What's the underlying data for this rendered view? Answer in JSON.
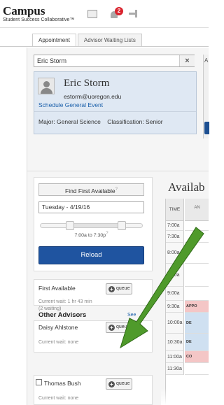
{
  "header": {
    "brand_name": "Campus",
    "brand_tagline": "Student Success Collaborative",
    "brand_tm": "™",
    "notification_count": "2"
  },
  "tabs": [
    {
      "label": "Appointment",
      "active": true
    },
    {
      "label": "Advisor Waiting Lists",
      "active": false
    }
  ],
  "student_search": {
    "value": "Eric Storm",
    "clear": "×"
  },
  "student_card": {
    "name": "Eric Storm",
    "email": "estorm@uoregon.edu",
    "action_link": "Schedule General Event",
    "info": "Major: General Science    Classification: Senior"
  },
  "right_panel": {
    "initial": "A"
  },
  "controls": {
    "find_first_label": "Find First Available",
    "help_mark": "?",
    "date_value": "Tuesday - 4/19/16",
    "time_range": "7:00a to 7:30p",
    "reload_label": "Reload"
  },
  "queues": {
    "first_available": {
      "label": "First Available",
      "wait": "Current wait: 1 hr 43 min",
      "waiting": "(2 waiting)",
      "button": "queue"
    },
    "other_heading": "Other Advisors",
    "see_link": "See",
    "advisors": [
      {
        "name": "Daisy Ahlstone",
        "wait": "Current wait: none",
        "button": "queue"
      },
      {
        "name": "Thomas Bush",
        "wait": "Current wait: none",
        "button": "queue"
      }
    ]
  },
  "schedule": {
    "title": "Availab",
    "time_header": "TIME",
    "col_header": "AN",
    "rows": [
      {
        "time": "7:00a",
        "slot": "",
        "color": "#ffffff"
      },
      {
        "time": "7:30a",
        "slot": "",
        "color": "#ffffff"
      },
      {
        "time": "8:00a",
        "slot": "",
        "color": "#ffffff"
      },
      {
        "time": "8:30a",
        "slot": "",
        "color": "#ffffff"
      },
      {
        "time": "9:00a",
        "slot": "",
        "color": "#ffffff"
      },
      {
        "time": "9:30a",
        "slot": "APPO",
        "color": "#f4c6c6"
      },
      {
        "time": "10:00a",
        "slot": "DE",
        "color": "#cfe0f1"
      },
      {
        "time": "10:30a",
        "slot": "DE",
        "color": "#cfe0f1"
      },
      {
        "time": "11:00a",
        "slot": "CO",
        "color": "#f4c6c6"
      },
      {
        "time": "11:30a",
        "slot": "",
        "color": "#ffffff"
      }
    ]
  },
  "annotation": {
    "arrow_color": "#4f9a2b"
  }
}
